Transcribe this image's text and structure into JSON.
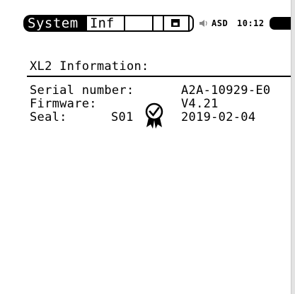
{
  "status_bar": {
    "tab_active": "System",
    "tab_info": "Inf",
    "floppy_icon": "floppy-disk-icon",
    "speaker_icon": "speaker-icon",
    "mode_label": "ASD",
    "time": "10:12",
    "battery_icon": "battery-icon"
  },
  "info": {
    "title": "XL2 Information:",
    "serial_label": "Serial number:",
    "serial_value": "A2A-10929-E0",
    "firmware_label": "Firmware:",
    "firmware_value": "V4.21",
    "seal_label": "Seal:",
    "seal_code": "S01",
    "seal_icon": "seal-badge-icon",
    "seal_date": "2019-02-04"
  }
}
